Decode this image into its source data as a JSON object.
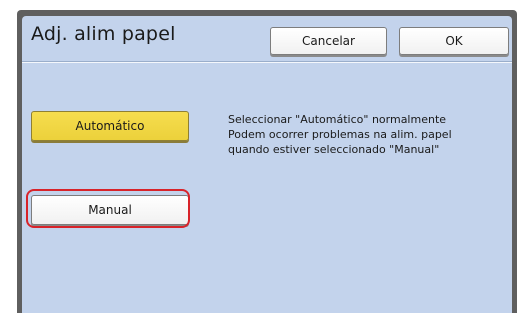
{
  "header": {
    "title": "Adj. alim papel",
    "cancel_label": "Cancelar",
    "ok_label": "OK"
  },
  "options": {
    "automatic_label": "Automático",
    "manual_label": "Manual",
    "selected": "Automático"
  },
  "description": {
    "line1": "Seleccionar \"Automático\" normalmente",
    "line2": "Podem ocorrer problemas na alim. papel",
    "line3": "quando estiver seleccionado \"Manual\""
  },
  "colors": {
    "selected_button": "#f0d640",
    "panel_background": "#c3d3ec",
    "highlight": "#d8232a"
  }
}
